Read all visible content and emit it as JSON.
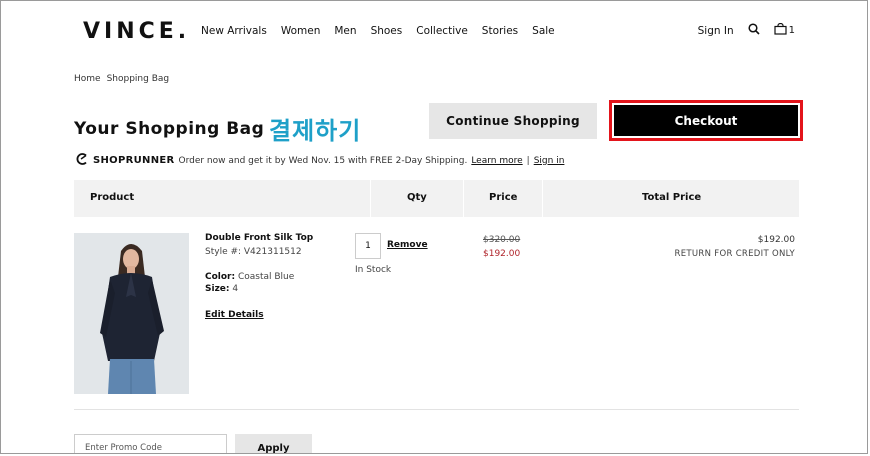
{
  "header": {
    "logo": "VINCE.",
    "nav": [
      "New Arrivals",
      "Women",
      "Men",
      "Shoes",
      "Collective",
      "Stories",
      "Sale"
    ],
    "sign_in": "Sign In",
    "bag_count": "1"
  },
  "breadcrumb": [
    "Home",
    "Shopping Bag"
  ],
  "page_title": "Your Shopping Bag",
  "annotation": "결제하기",
  "buttons": {
    "continue_shopping": "Continue Shopping",
    "checkout": "Checkout",
    "apply": "Apply"
  },
  "shoprunner": {
    "logo": "SHOPRUNNER",
    "message": "Order now and get it by Wed Nov. 15 with FREE 2-Day Shipping.",
    "learn_more": "Learn more",
    "separator": "|",
    "sign_in": "Sign in"
  },
  "table": {
    "headers": [
      "Product",
      "Qty",
      "Price",
      "Total Price"
    ]
  },
  "item": {
    "name": "Double Front Silk Top",
    "style": "Style #: V421311512",
    "color_label": "Color:",
    "color": "Coastal Blue",
    "size_label": "Size:",
    "size": "4",
    "edit": "Edit Details",
    "qty": "1",
    "remove": "Remove",
    "stock": "In Stock",
    "price_original": "$320.00",
    "price_sale": "$192.00",
    "total": "$192.00",
    "return_note": "RETURN FOR CREDIT ONLY"
  },
  "promo": {
    "placeholder": "Enter Promo Code"
  },
  "colors": {
    "checkout_outline": "#e3141b",
    "annotation": "#1ea0c8",
    "sale_price": "#b0242b"
  }
}
